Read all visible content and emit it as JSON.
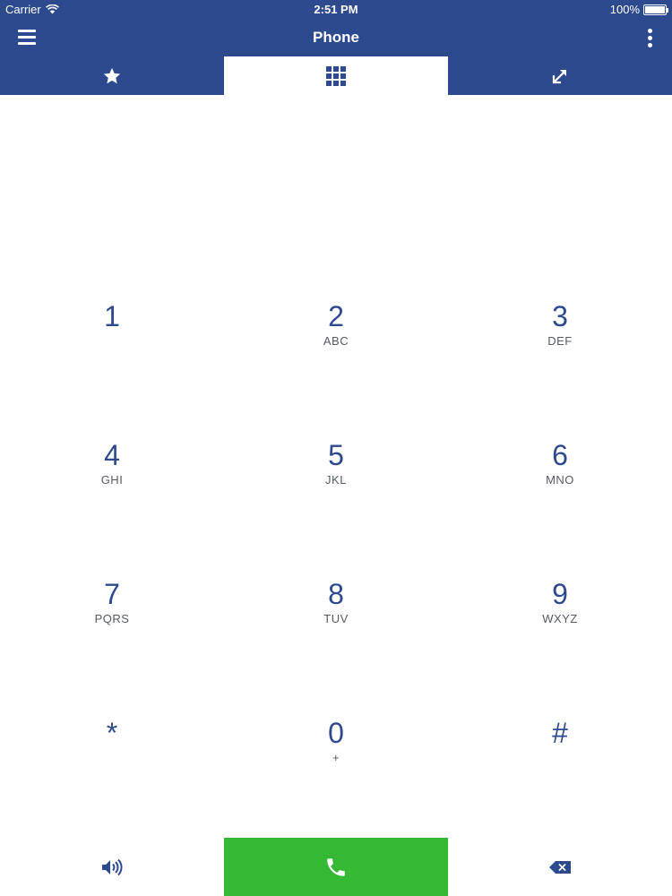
{
  "status_bar": {
    "carrier": "Carrier",
    "time": "2:51 PM",
    "battery": "100%"
  },
  "header": {
    "title": "Phone",
    "menu_icon": "hamburger-menu-icon",
    "more_icon": "vertical-dots-icon"
  },
  "tabs": [
    {
      "icon": "star-icon",
      "active": false
    },
    {
      "icon": "keypad-grid-icon",
      "active": true
    },
    {
      "icon": "call-transfer-icon",
      "active": false
    }
  ],
  "keypad": {
    "keys": [
      {
        "digit": "1",
        "letters": ""
      },
      {
        "digit": "2",
        "letters": "ABC"
      },
      {
        "digit": "3",
        "letters": "DEF"
      },
      {
        "digit": "4",
        "letters": "GHI"
      },
      {
        "digit": "5",
        "letters": "JKL"
      },
      {
        "digit": "6",
        "letters": "MNO"
      },
      {
        "digit": "7",
        "letters": "PQRS"
      },
      {
        "digit": "8",
        "letters": "TUV"
      },
      {
        "digit": "9",
        "letters": "WXYZ"
      },
      {
        "digit": "*",
        "letters": ""
      },
      {
        "digit": "0",
        "letters": "+"
      },
      {
        "digit": "#",
        "letters": ""
      }
    ]
  },
  "bottom_bar": {
    "speaker_icon": "speaker-icon",
    "call_icon": "phone-handset-icon",
    "backspace_icon": "backspace-icon"
  },
  "colors": {
    "primary": "#2e4a8f",
    "call_green": "#35b834",
    "letters_gray": "#555a66"
  }
}
